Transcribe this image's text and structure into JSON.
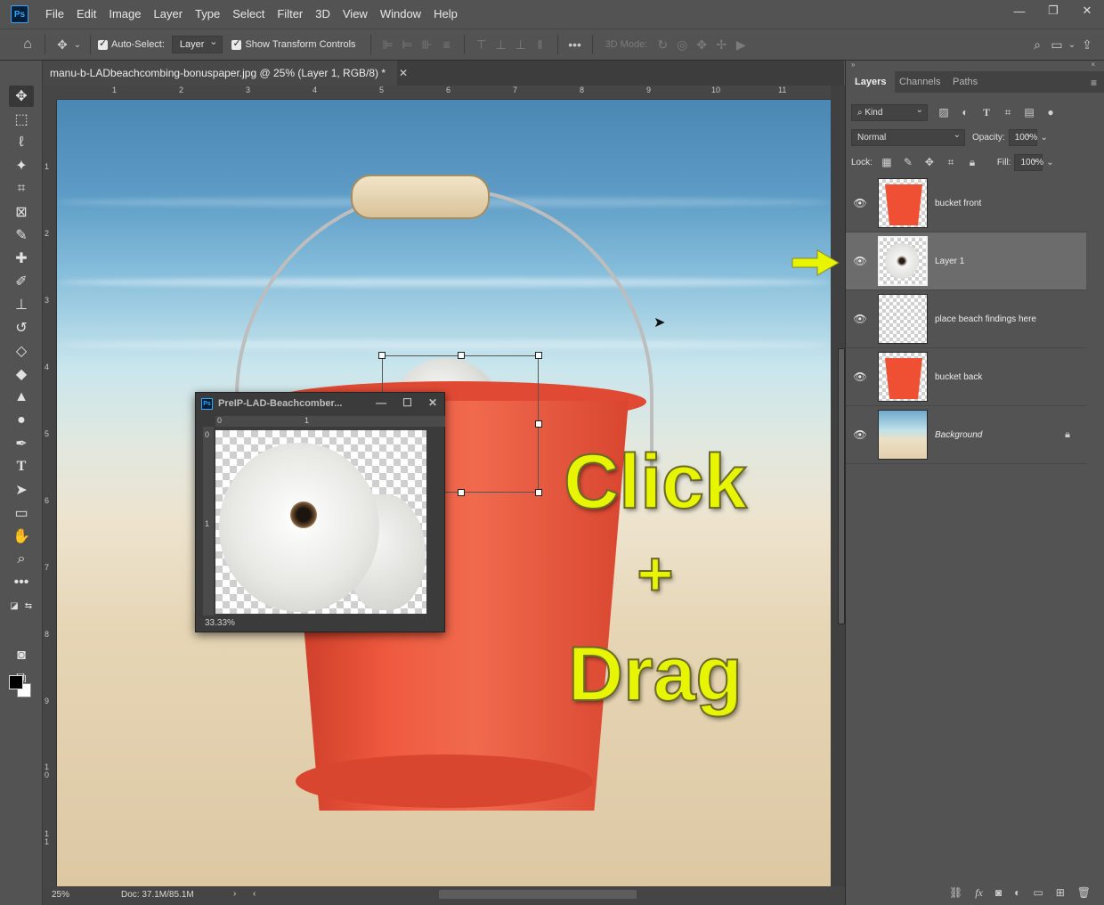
{
  "app": {
    "logo": "Ps"
  },
  "menu": [
    "File",
    "Edit",
    "Image",
    "Layer",
    "Type",
    "Select",
    "Filter",
    "3D",
    "View",
    "Window",
    "Help"
  ],
  "options": {
    "auto_select_label": "Auto-Select:",
    "auto_select_value": "Layer",
    "show_transform_label": "Show Transform Controls",
    "three_d_mode_label": "3D Mode:"
  },
  "document": {
    "tab_title": "manu-b-LADbeachcombing-bonuspaper.jpg @ 25% (Layer 1, RGB/8) *",
    "zoom": "25%",
    "doc_size": "Doc: 37.1M/85.1M",
    "ruler_h": [
      "1",
      "2",
      "3",
      "4",
      "5",
      "6",
      "7",
      "8",
      "9",
      "10",
      "11"
    ],
    "ruler_v": [
      "1",
      "2",
      "3",
      "4",
      "5",
      "6",
      "7",
      "8",
      "9",
      "1\n0",
      "1\n1"
    ]
  },
  "overlay_text": {
    "click": "Click",
    "plus": "+",
    "drag": "Drag"
  },
  "floating_window": {
    "title": "PreIP-LAD-Beachcomber...",
    "zoom": "33.33%",
    "ruler_h": [
      "0",
      "1"
    ],
    "ruler_v": [
      "0",
      "1"
    ]
  },
  "panel": {
    "tabs": [
      "Layers",
      "Channels",
      "Paths"
    ],
    "active_tab": "Layers",
    "filter_kind": "Kind",
    "blend_mode": "Normal",
    "opacity_label": "Opacity:",
    "opacity_value": "100%",
    "lock_label": "Lock:",
    "fill_label": "Fill:",
    "fill_value": "100%",
    "layers": [
      {
        "name": "bucket front",
        "thumb": "bucket",
        "visible": true,
        "selected": false
      },
      {
        "name": "Layer 1",
        "thumb": "shell",
        "visible": true,
        "selected": true
      },
      {
        "name": "place beach findings here",
        "thumb": "transparent",
        "visible": true,
        "selected": false
      },
      {
        "name": "bucket back",
        "thumb": "bucket",
        "visible": true,
        "selected": false
      },
      {
        "name": "Background",
        "thumb": "background",
        "visible": true,
        "selected": false,
        "locked": true
      }
    ]
  },
  "colors": {
    "accent": "#31a8ff",
    "annotation": "#e7f600",
    "bucket": "#ef4f33"
  }
}
